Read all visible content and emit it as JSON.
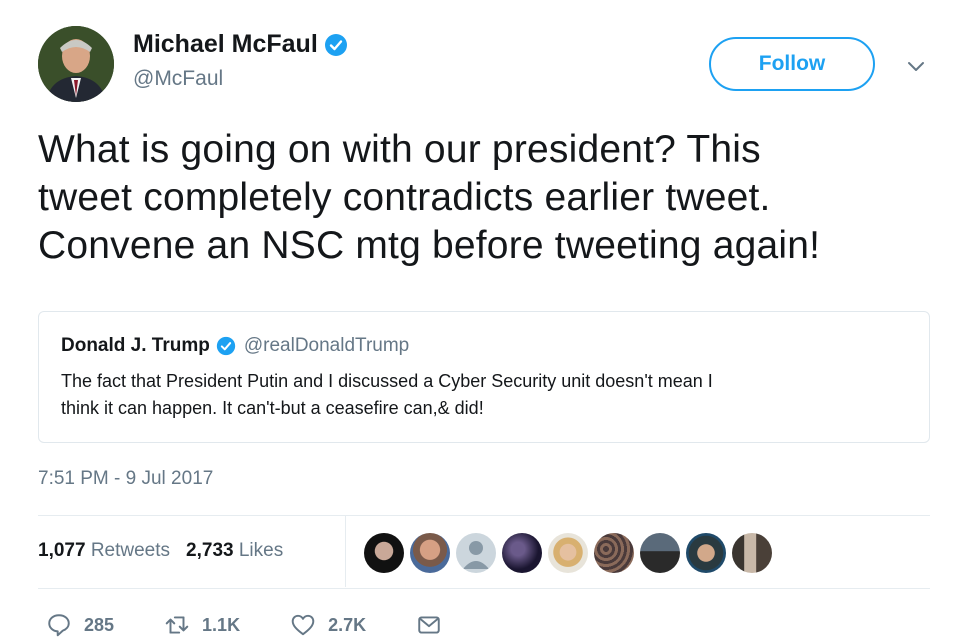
{
  "author": {
    "name": "Michael McFaul",
    "handle": "@McFaul",
    "verified": true
  },
  "follow_button": {
    "label": "Follow"
  },
  "tweet": {
    "text_lines": [
      "What is going on with our president? This",
      "tweet completely contradicts earlier tweet.",
      "Convene an NSC mtg before tweeting again!"
    ]
  },
  "quoted_tweet": {
    "name": "Donald J. Trump",
    "handle": "@realDonaldTrump",
    "verified": true,
    "text_lines": [
      "The fact that President Putin and I discussed a Cyber Security unit  doesn't mean I",
      "think it can happen. It can't-but a ceasefire can,& did!"
    ]
  },
  "timestamp": "7:51 PM - 9 Jul 2017",
  "stats": {
    "retweets_count": "1,077",
    "retweets_label": "Retweets",
    "likes_count": "2,733",
    "likes_label": "Likes"
  },
  "actions": {
    "reply_count": "285",
    "retweet_count": "1.1K",
    "like_count": "2.7K"
  },
  "colors": {
    "accent": "#1da1f2",
    "text": "#14171a",
    "muted": "#657786",
    "border": "#e1e8ed"
  },
  "icons": {
    "verified": "verified-badge-icon",
    "chevron": "chevron-down-icon",
    "reply": "reply-icon",
    "retweet": "retweet-icon",
    "like": "heart-icon",
    "dm": "envelope-icon"
  }
}
